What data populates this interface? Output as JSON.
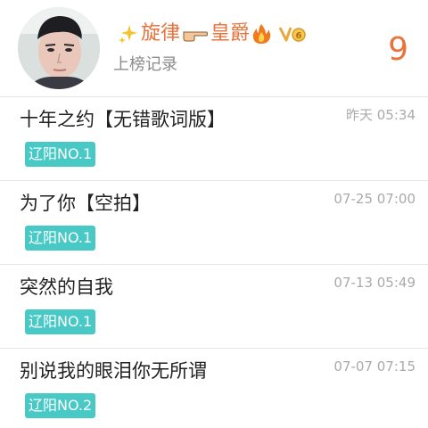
{
  "header": {
    "username": "旋律",
    "username_suffix": "皇爵",
    "rank_label": "上榜记录",
    "rank_count": "9",
    "icons": {
      "sparkle": "sparkle-icon",
      "hand": "pointing-hand-icon",
      "fire": "fire-icon",
      "vip": "vip-badge-icon",
      "avatar": "avatar"
    }
  },
  "colors": {
    "accent": "#e8733c",
    "badge": "#48c9c6",
    "time": "#aaaaaa",
    "divider": "#e6e6e6"
  },
  "songs": [
    {
      "title": "十年之约【无错歌词版】",
      "time": "昨天 05:34",
      "badge": "辽阳NO.1"
    },
    {
      "title": "为了你【空拍】",
      "time": "07-25 07:00",
      "badge": "辽阳NO.1"
    },
    {
      "title": "突然的自我",
      "time": "07-13 05:49",
      "badge": "辽阳NO.1"
    },
    {
      "title": "别说我的眼泪你无所谓",
      "time": "07-07 07:15",
      "badge": "辽阳NO.2"
    }
  ]
}
